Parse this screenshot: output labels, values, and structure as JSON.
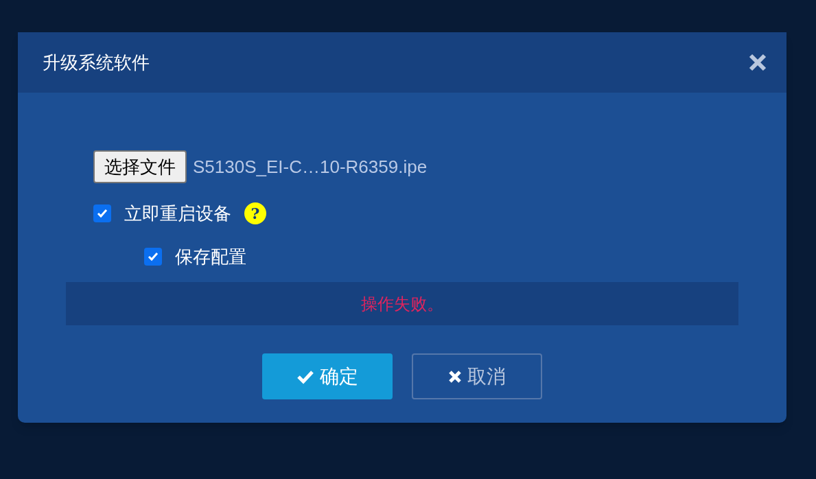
{
  "dialog": {
    "title": "升级系统软件"
  },
  "file": {
    "button": "选择文件",
    "name": "S5130S_EI-C…10-R6359.ipe"
  },
  "options": [
    {
      "label": "立即重启设备",
      "checked": true,
      "help": "?",
      "children": [
        {
          "label": "保存配置",
          "checked": true
        }
      ]
    }
  ],
  "message": "操作失败。",
  "buttons": [
    {
      "label": "确定",
      "kind": "primary"
    },
    {
      "label": "取消",
      "kind": "secondary"
    }
  ]
}
